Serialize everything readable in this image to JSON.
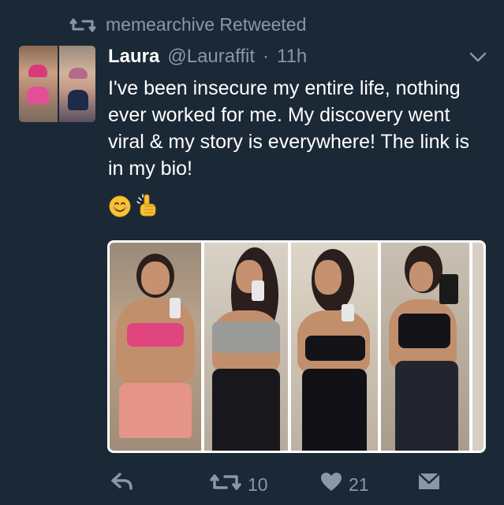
{
  "retweet": {
    "icon": "retweet-icon",
    "text": "memearchive Retweeted"
  },
  "tweet": {
    "author_name": "Laura",
    "handle": "@Lauraffit",
    "separator": "·",
    "time": "11h",
    "text": "I've been insecure my entire life, nothing ever worked for me. My discovery went viral & my story is everywhere! The link is in my bio!",
    "emojis": [
      "smiling-face-emoji",
      "pointing-up-emoji"
    ]
  },
  "actions": {
    "reply_icon": "reply-icon",
    "retweet_count": "10",
    "like_count": "21",
    "dm_icon": "direct-message-icon"
  },
  "colors": {
    "background": "#1b2836",
    "muted": "#8899a6",
    "text": "#ffffff"
  }
}
